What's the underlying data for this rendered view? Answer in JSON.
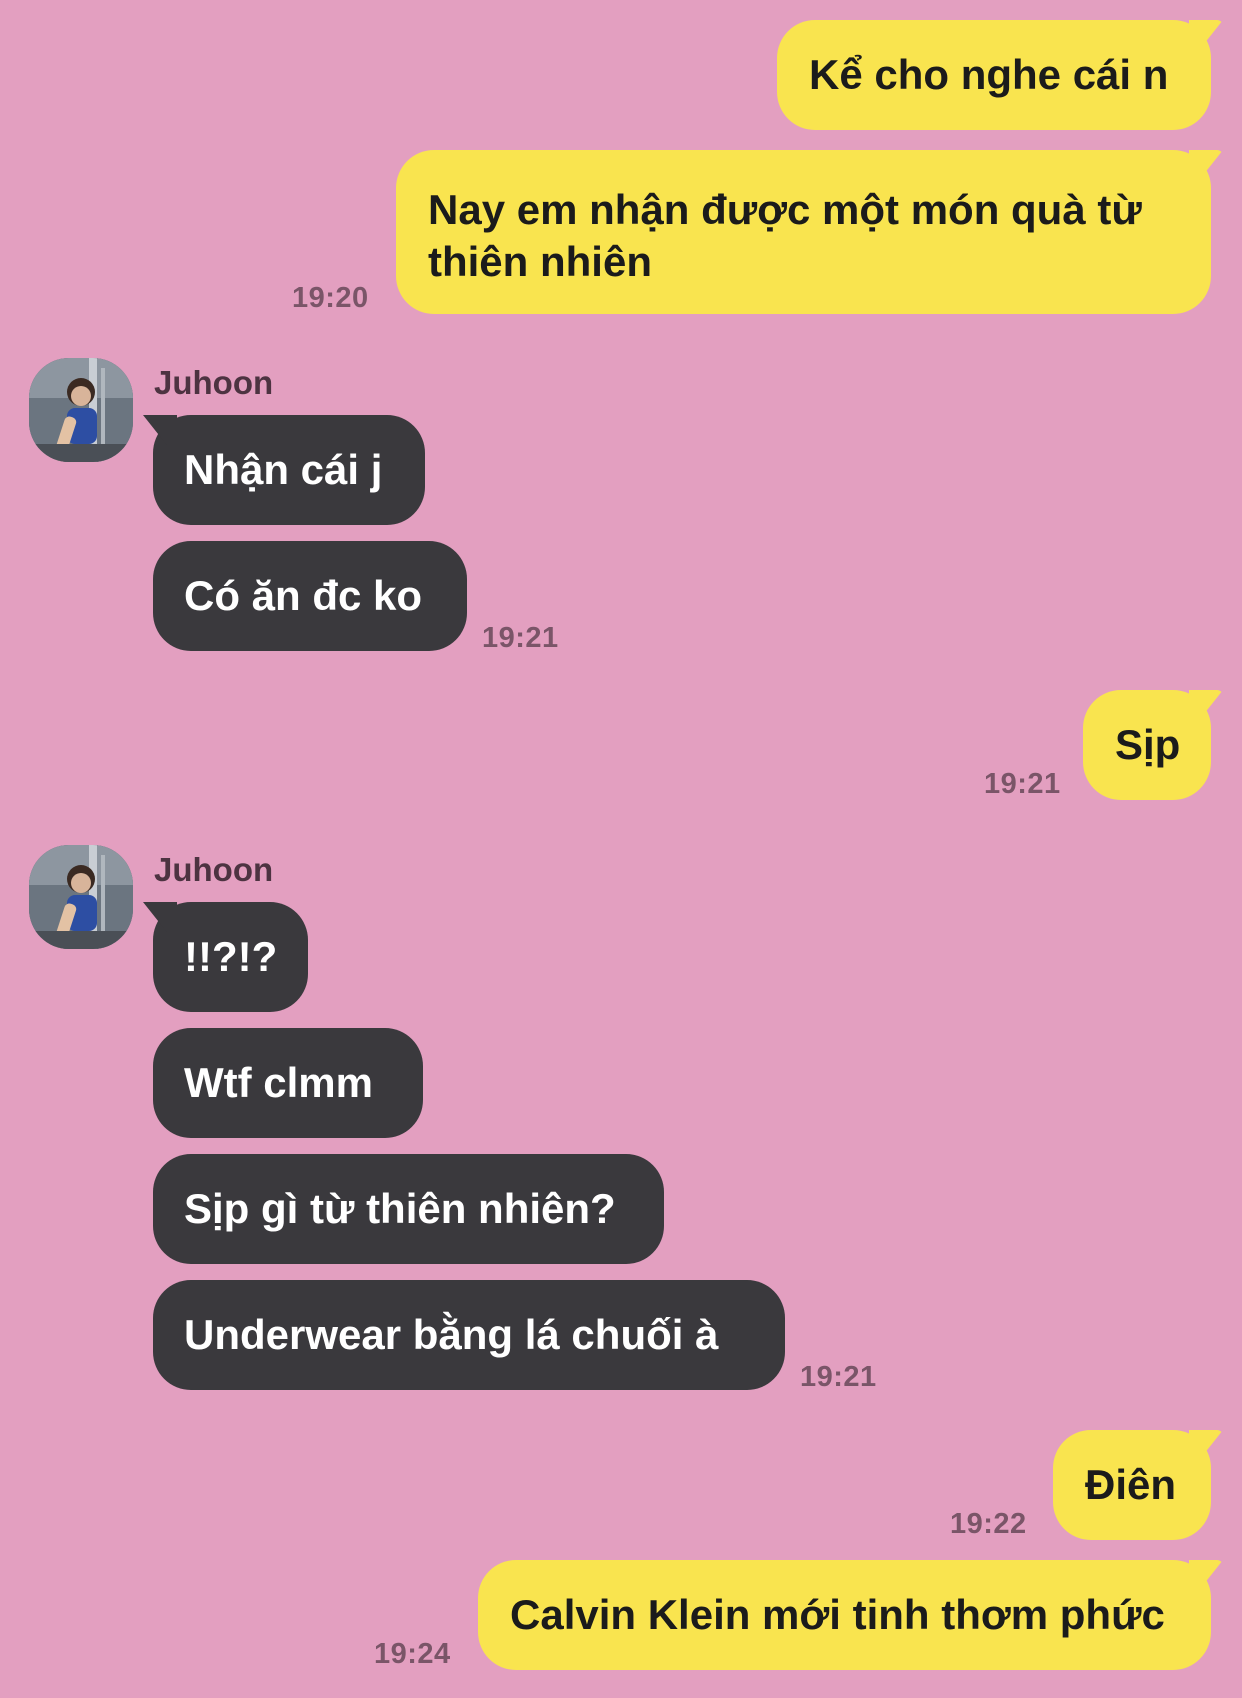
{
  "colors": {
    "background": "#e39fc0",
    "my_bubble": "#f9e44f",
    "their_bubble": "#3a393d",
    "timestamp": "#7a5568"
  },
  "messages": [
    {
      "from": "me",
      "text": "Kể cho nghe cái n"
    },
    {
      "from": "me",
      "text": "Nay em nhận được một món quà từ thiên nhiên",
      "time": "19:20"
    },
    {
      "from": "Juhoon",
      "text": "Nhận cái j"
    },
    {
      "from": "Juhoon",
      "text": "Có ăn đc ko",
      "time": "19:21"
    },
    {
      "from": "me",
      "text": "Sịp",
      "time": "19:21"
    },
    {
      "from": "Juhoon",
      "text": "!!?!?"
    },
    {
      "from": "Juhoon",
      "text": "Wtf clmm"
    },
    {
      "from": "Juhoon",
      "text": "Sịp gì từ thiên nhiên?"
    },
    {
      "from": "Juhoon",
      "text": "Underwear bằng lá chuối à",
      "time": "19:21"
    },
    {
      "from": "me",
      "text": "Điên",
      "time": "19:22"
    },
    {
      "from": "me",
      "text": "Calvin Klein mới tinh thơm phức",
      "time": "19:24"
    }
  ],
  "contact": {
    "name": "Juhoon",
    "avatar_icon": "profile-photo-avatar"
  }
}
